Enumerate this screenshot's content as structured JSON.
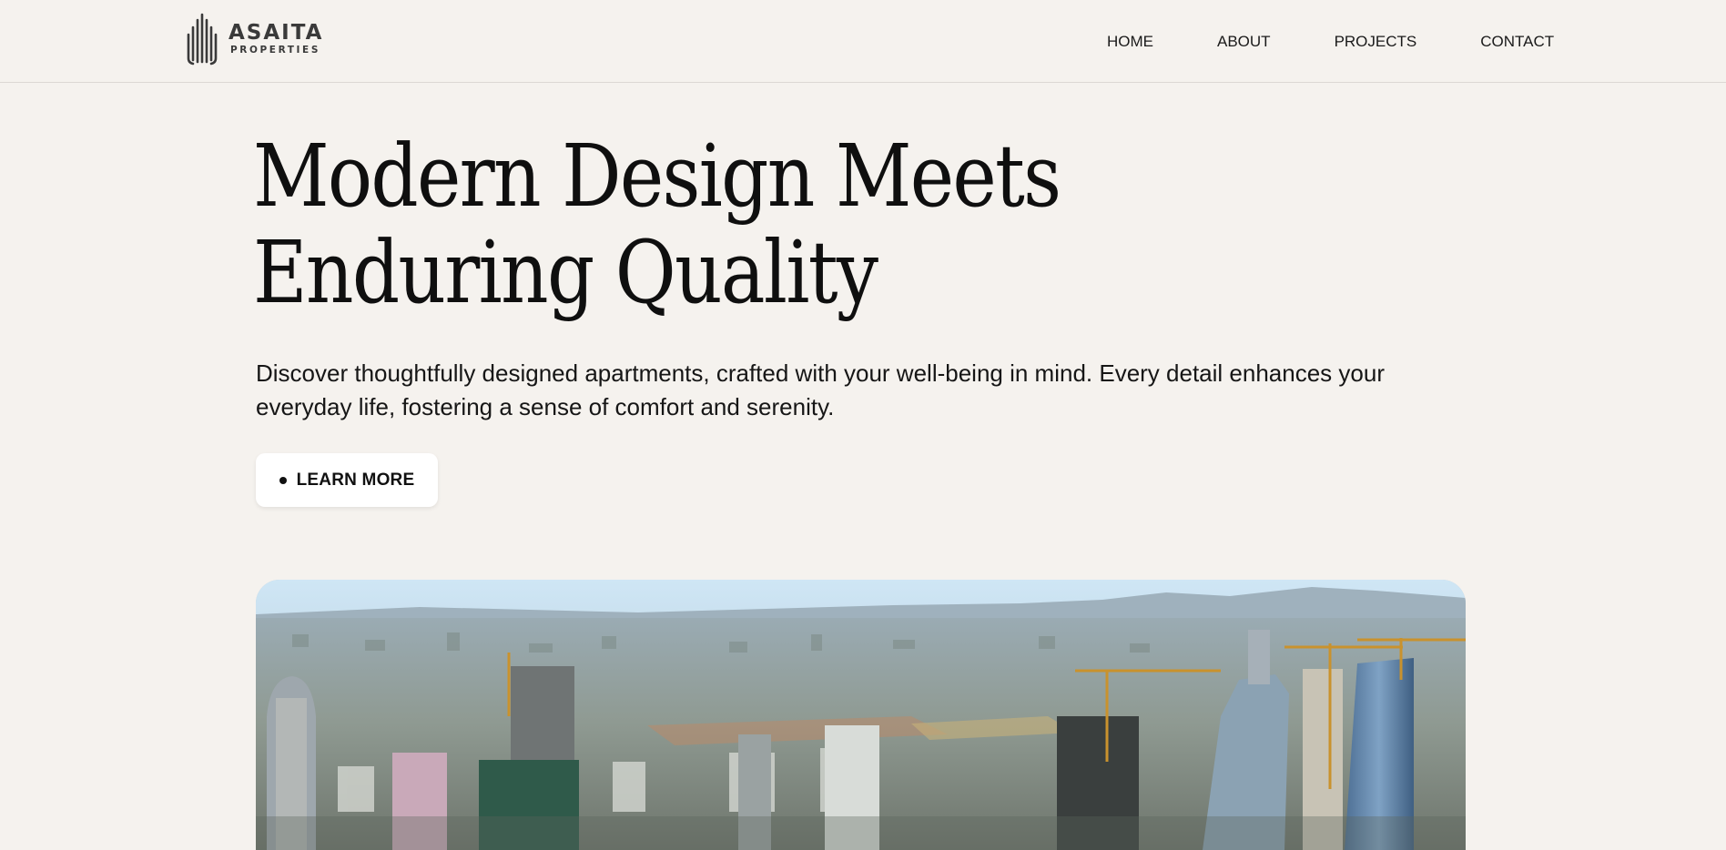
{
  "brand": {
    "name": "ASAITA",
    "sub": "PROPERTIES",
    "logo_icon": "building-bars-logo-icon",
    "color": "#3a3a3a"
  },
  "nav": {
    "items": [
      {
        "label": "HOME"
      },
      {
        "label": "ABOUT"
      },
      {
        "label": "PROJECTS"
      },
      {
        "label": "CONTACT"
      }
    ]
  },
  "hero": {
    "title": "Modern Design Meets Enduring Quality",
    "text": "Discover thoughtfully designed apartments, crafted with your well-being in mind. Every detail enhances your everyday life, fostering a sense of comfort and serenity.",
    "cta": {
      "label": "LEARN MORE",
      "icon": "bullet-dot-icon"
    },
    "image": {
      "subject": "aerial-city-skyline-photo"
    }
  },
  "colors": {
    "background": "#f5f2ee",
    "text": "#141414",
    "button_bg": "#ffffff",
    "divider": "#dcd8d3"
  }
}
